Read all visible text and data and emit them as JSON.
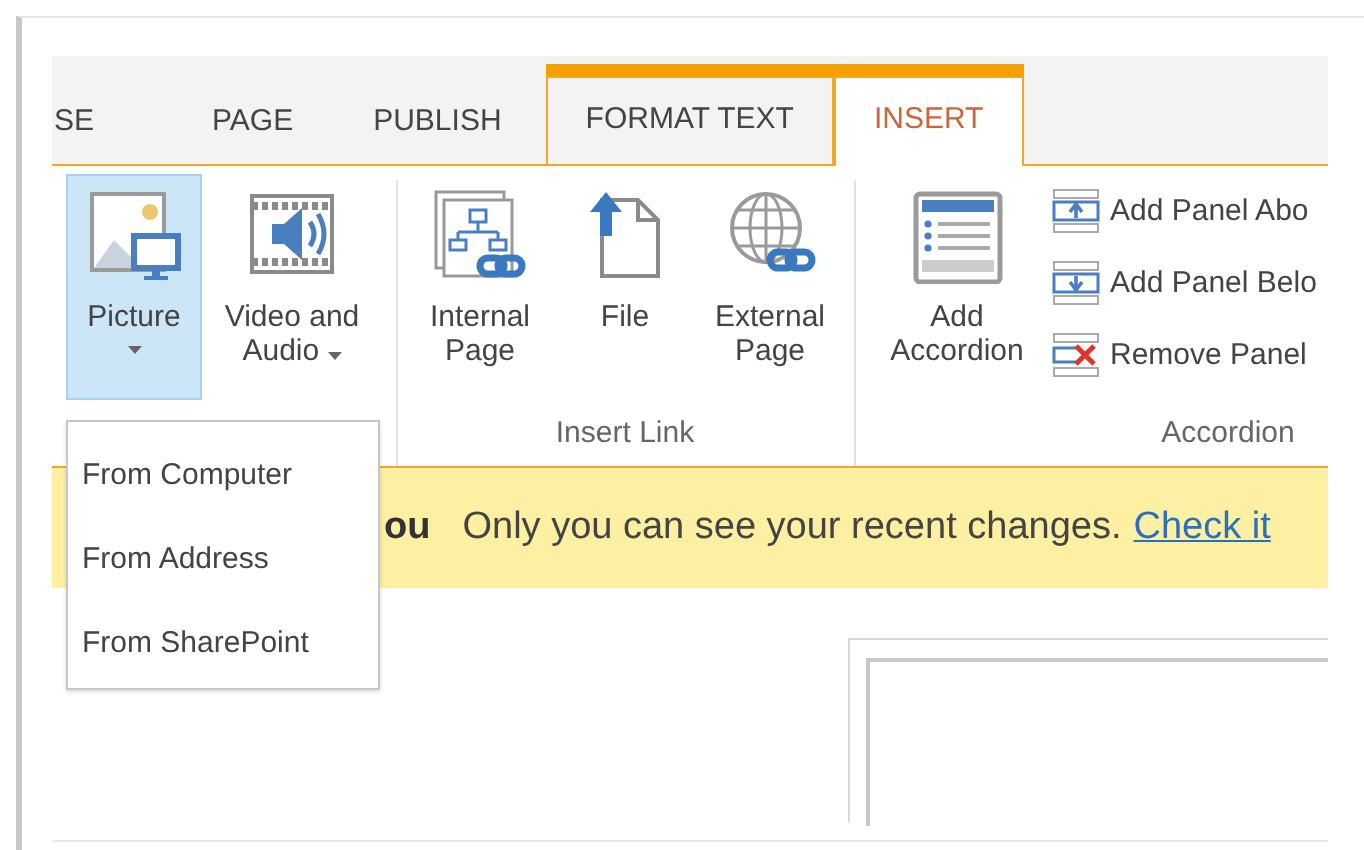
{
  "tabs": [
    {
      "label": "SE",
      "selected": false,
      "contextual": false
    },
    {
      "label": "PAGE",
      "selected": false,
      "contextual": false
    },
    {
      "label": "PUBLISH",
      "selected": false,
      "contextual": false
    },
    {
      "label": "FORMAT TEXT",
      "selected": false,
      "contextual": true
    },
    {
      "label": "INSERT",
      "selected": true,
      "contextual": true
    }
  ],
  "ribbon": {
    "groups": [
      {
        "buttons": [
          {
            "kind": "large",
            "lines": [
              "Picture"
            ],
            "dropdown": true,
            "expanded": true
          },
          {
            "kind": "large",
            "lines": [
              "Video and",
              "Audio"
            ],
            "dropdown": true,
            "expanded": false
          }
        ]
      },
      {
        "label": "Insert Link",
        "buttons": [
          {
            "kind": "large",
            "lines": [
              "Internal",
              "Page"
            ]
          },
          {
            "kind": "large",
            "lines": [
              "File"
            ]
          },
          {
            "kind": "large",
            "lines": [
              "External",
              "Page"
            ]
          }
        ]
      },
      {
        "label": "Accordion",
        "buttons": [
          {
            "kind": "large",
            "lines": [
              "Add",
              "Accordion"
            ]
          },
          {
            "kind": "small",
            "lines": [
              "Add Panel Abo"
            ]
          },
          {
            "kind": "small",
            "lines": [
              "Add Panel Belo"
            ]
          },
          {
            "kind": "small",
            "lines": [
              "Remove Panel"
            ]
          }
        ]
      }
    ]
  },
  "picture_menu": {
    "items": [
      "From Computer",
      "From Address",
      "From SharePoint"
    ]
  },
  "status_bar": {
    "title_fragment": "ou",
    "message": "Only you can see your recent changes.",
    "link": "Check it"
  }
}
